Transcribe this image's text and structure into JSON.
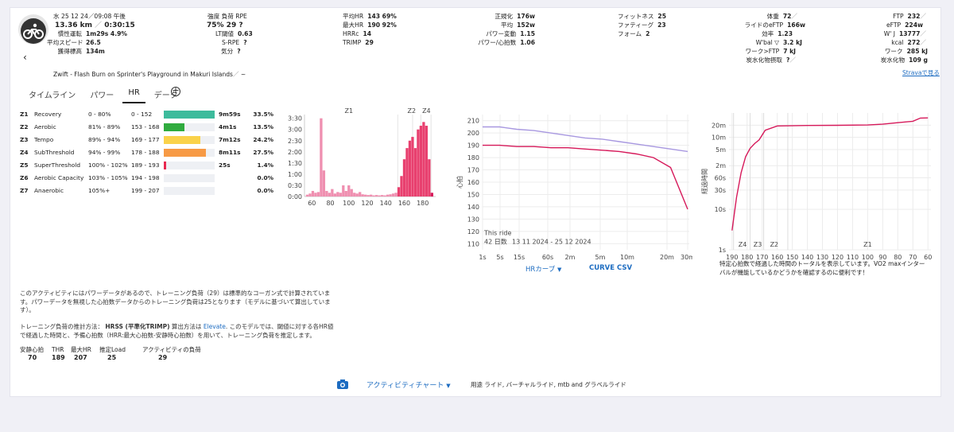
{
  "header": {
    "date_time": "水 25 12 24／09:08 午後",
    "distance": "13.36 km",
    "duration": "0:30:15",
    "rows_left": [
      {
        "label": "慣性運転",
        "value": "1m29s  4.9%"
      },
      {
        "label": "平均スピード",
        "value": "26.5"
      },
      {
        "label": "獲得標高",
        "value": "134m"
      }
    ],
    "col2": {
      "header": "強度  負荷  RPE",
      "values": "75%  29  ?",
      "lt_label": "LT閾値",
      "lt_value": "0.63",
      "srpe_label": "S-RPE",
      "srpe_value": "?",
      "mood_label": "気分",
      "mood_value": "?"
    },
    "col3": [
      {
        "label": "平均HR",
        "value": "143  69%"
      },
      {
        "label": "最大HR",
        "value": "190  92%"
      },
      {
        "label": "HRRc",
        "value": "14"
      },
      {
        "label": "TRIMP",
        "value": "29"
      }
    ],
    "col4": [
      {
        "label": "正規化",
        "value": "176w"
      },
      {
        "label": "平均",
        "value": "152w"
      },
      {
        "label": "パワー変動",
        "value": "1.15"
      },
      {
        "label": "パワー/心拍数",
        "value": "1.06"
      }
    ],
    "col5": [
      {
        "label": "フィットネス",
        "value": "25"
      },
      {
        "label": "ファティーグ",
        "value": "23"
      },
      {
        "label": "フォーム",
        "value": "2"
      }
    ],
    "col6": [
      {
        "label": "体重",
        "value": "72"
      },
      {
        "label": "ライドのeFTP",
        "value": "166w"
      },
      {
        "label": "効率",
        "value": "1.23"
      },
      {
        "label": "W'bal ▽",
        "value": "3.2 kJ"
      },
      {
        "label": "ワーク>FTP",
        "value": "7 kJ"
      },
      {
        "label": "炭水化物摂取",
        "value": "?"
      }
    ],
    "col7": [
      {
        "label": "FTP",
        "value": "232"
      },
      {
        "label": "eFTP",
        "value": "224w"
      },
      {
        "label": "W' J",
        "value": "13777"
      },
      {
        "label": "kcal",
        "value": "272"
      },
      {
        "label": "ワーク",
        "value": "285 kJ"
      },
      {
        "label": "炭水化物",
        "value": "109 g"
      }
    ],
    "activity_name": "Zwift - Flash Burn on Sprinter's Playground in Makuri Islands",
    "strava_link": "Stravaで見る"
  },
  "tabs": [
    "タイムライン",
    "パワー",
    "HR",
    "データ"
  ],
  "active_tab": "HR",
  "zones": [
    {
      "z": "Z1",
      "name": "Recovery",
      "pct": "0 - 80%",
      "range": "0 - 152",
      "time": "9m59s",
      "share": "33.5%",
      "frac": 0.335,
      "color": "#3dbb9c"
    },
    {
      "z": "Z2",
      "name": "Aerobic",
      "pct": "81% - 89%",
      "range": "153 - 168",
      "time": "4m1s",
      "share": "13.5%",
      "frac": 0.135,
      "color": "#2fab3e"
    },
    {
      "z": "Z3",
      "name": "Tempo",
      "pct": "89% - 94%",
      "range": "169 - 177",
      "time": "7m12s",
      "share": "24.2%",
      "frac": 0.242,
      "color": "#fad24a"
    },
    {
      "z": "Z4",
      "name": "SubThreshold",
      "pct": "94% - 99%",
      "range": "178 - 188",
      "time": "8m11s",
      "share": "27.5%",
      "frac": 0.275,
      "color": "#f79a45"
    },
    {
      "z": "Z5",
      "name": "SuperThreshold",
      "pct": "100% - 102%",
      "range": "189 - 193",
      "time": "25s",
      "share": "1.4%",
      "frac": 0.014,
      "color": "#e8284f"
    },
    {
      "z": "Z6",
      "name": "Aerobic Capacity",
      "pct": "103% - 105%",
      "range": "194 - 198",
      "time": "",
      "share": "0.0%",
      "frac": 0,
      "color": "#b21a7a"
    },
    {
      "z": "Z7",
      "name": "Anaerobic",
      "pct": "105%+",
      "range": "199 - 207",
      "time": "",
      "share": "0.0%",
      "frac": 0,
      "color": "#7a1a8a"
    }
  ],
  "notes": {
    "p1": "このアクティビティにはパワーデータがあるので、トレーニング負荷（29）は標準的なコーガン式で計算されています。パワーデータを無視した心拍数データからのトレーニング負荷は25となります（モデルに基づいて算出しています）。",
    "p2_prefix": "トレーニング負荷の推計方法：",
    "p2_method": "HRSS (平準化TRIMP)",
    "p2_mid": "算出方法は",
    "p2_link": "Elevate",
    "p2_rest": ". このモデルでは、閾値に対する各HR値で経過した時間と、予備心拍数（HRR:最大心拍数-安静時心拍数）を用いて、トレーニング負荷を推定します。",
    "table_headers": [
      "安静心拍",
      "THR",
      "最大HR",
      "推定Load",
      "アクティビティの負荷"
    ],
    "table_values": [
      "70",
      "189",
      "207",
      "25",
      "29"
    ]
  },
  "curve_controls": {
    "hr_curve": "HRカーブ",
    "csv": "CURVE CSV"
  },
  "zone_curve_note": "特定心拍数で経過した時間のトータルを表示しています。VO2 maxインターバルが機能しているかどうかを確認するのに便利です！",
  "footer": {
    "chart_menu": "アクティビティチャート",
    "usage": "用途 ライド, バーチャルライド, mtb and グラベルライド"
  },
  "chart_data": [
    {
      "type": "bar",
      "title": "",
      "x_ticks": [
        "60",
        "80",
        "100",
        "120",
        "140",
        "160",
        "180"
      ],
      "y_ticks": [
        "0:00",
        "0:30",
        "1:00",
        "1:30",
        "2:00",
        "2:30",
        "3:00",
        "3:30"
      ],
      "zone_labels": [
        "Z1",
        "Z2",
        "Z4"
      ],
      "ylim_seconds": [
        0,
        220
      ],
      "bins_x": [
        55,
        58,
        61,
        64,
        67,
        70,
        73,
        76,
        79,
        82,
        85,
        88,
        91,
        94,
        97,
        100,
        103,
        106,
        109,
        112,
        115,
        118,
        121,
        124,
        127,
        130,
        133,
        136,
        139,
        142,
        145,
        148,
        151,
        154,
        157,
        160,
        163,
        166,
        169,
        172,
        175,
        178,
        181,
        184,
        187,
        190
      ],
      "seconds": [
        5,
        8,
        15,
        10,
        12,
        210,
        70,
        15,
        10,
        20,
        8,
        12,
        10,
        30,
        15,
        30,
        20,
        10,
        8,
        12,
        6,
        5,
        4,
        5,
        3,
        4,
        3,
        4,
        3,
        5,
        6,
        8,
        10,
        25,
        55,
        100,
        130,
        150,
        160,
        130,
        180,
        190,
        200,
        190,
        100,
        10
      ]
    },
    {
      "type": "line",
      "y_ticks": [
        "110",
        "120",
        "130",
        "140",
        "150",
        "160",
        "170",
        "180",
        "190",
        "200",
        "210"
      ],
      "ylabel": "心拍",
      "x_ticks": [
        "1s",
        "5s",
        "15s",
        "60s",
        "2m",
        "5m",
        "10m",
        "20m",
        "30m"
      ],
      "series": [
        {
          "name": "This ride",
          "color": "#d6195a",
          "values": [
            190,
            190,
            189,
            189,
            188,
            188,
            187,
            186,
            185,
            183,
            180,
            172,
            138
          ]
        },
        {
          "name": "42 日数",
          "color": "#a898e0",
          "values": [
            205,
            205,
            203,
            202,
            200,
            198,
            196,
            195,
            193,
            191,
            189,
            187,
            185
          ]
        }
      ],
      "legend_range": "13 11 2024 - 25 12 2024"
    },
    {
      "type": "line",
      "ylabel": "経過時間",
      "y_ticks": [
        "1s",
        "10s",
        "30s",
        "60s",
        "2m",
        "5m",
        "10m",
        "20m"
      ],
      "x_ticks": [
        "190",
        "180",
        "170",
        "160",
        "150",
        "140",
        "130",
        "120",
        "110",
        "100",
        "90",
        "80",
        "70",
        "60"
      ],
      "zone_labels": [
        "Z4",
        "Z3",
        "Z2",
        "Z1"
      ],
      "series": [
        {
          "name": "",
          "color": "#d6195a",
          "hr": [
            190,
            187,
            184,
            181,
            178,
            175,
            172,
            168,
            160,
            140,
            120,
            100,
            90,
            80,
            70,
            65,
            60
          ],
          "seconds": [
            3,
            20,
            80,
            200,
            320,
            420,
            520,
            900,
            1150,
            1180,
            1190,
            1210,
            1270,
            1380,
            1500,
            1800,
            1815
          ]
        }
      ]
    }
  ]
}
